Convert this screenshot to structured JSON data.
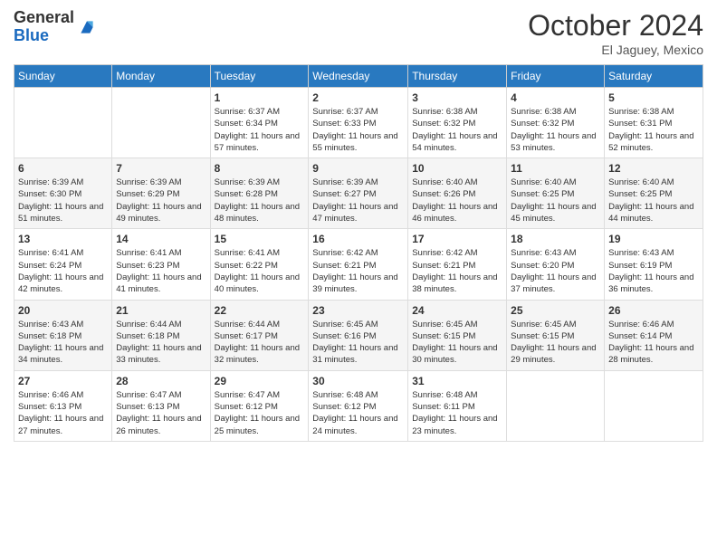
{
  "logo": {
    "general": "General",
    "blue": "Blue"
  },
  "title": "October 2024",
  "location": "El Jaguey, Mexico",
  "days_of_week": [
    "Sunday",
    "Monday",
    "Tuesday",
    "Wednesday",
    "Thursday",
    "Friday",
    "Saturday"
  ],
  "weeks": [
    [
      {
        "day": "",
        "sunrise": "",
        "sunset": "",
        "daylight": ""
      },
      {
        "day": "",
        "sunrise": "",
        "sunset": "",
        "daylight": ""
      },
      {
        "day": "1",
        "sunrise": "Sunrise: 6:37 AM",
        "sunset": "Sunset: 6:34 PM",
        "daylight": "Daylight: 11 hours and 57 minutes."
      },
      {
        "day": "2",
        "sunrise": "Sunrise: 6:37 AM",
        "sunset": "Sunset: 6:33 PM",
        "daylight": "Daylight: 11 hours and 55 minutes."
      },
      {
        "day": "3",
        "sunrise": "Sunrise: 6:38 AM",
        "sunset": "Sunset: 6:32 PM",
        "daylight": "Daylight: 11 hours and 54 minutes."
      },
      {
        "day": "4",
        "sunrise": "Sunrise: 6:38 AM",
        "sunset": "Sunset: 6:32 PM",
        "daylight": "Daylight: 11 hours and 53 minutes."
      },
      {
        "day": "5",
        "sunrise": "Sunrise: 6:38 AM",
        "sunset": "Sunset: 6:31 PM",
        "daylight": "Daylight: 11 hours and 52 minutes."
      }
    ],
    [
      {
        "day": "6",
        "sunrise": "Sunrise: 6:39 AM",
        "sunset": "Sunset: 6:30 PM",
        "daylight": "Daylight: 11 hours and 51 minutes."
      },
      {
        "day": "7",
        "sunrise": "Sunrise: 6:39 AM",
        "sunset": "Sunset: 6:29 PM",
        "daylight": "Daylight: 11 hours and 49 minutes."
      },
      {
        "day": "8",
        "sunrise": "Sunrise: 6:39 AM",
        "sunset": "Sunset: 6:28 PM",
        "daylight": "Daylight: 11 hours and 48 minutes."
      },
      {
        "day": "9",
        "sunrise": "Sunrise: 6:39 AM",
        "sunset": "Sunset: 6:27 PM",
        "daylight": "Daylight: 11 hours and 47 minutes."
      },
      {
        "day": "10",
        "sunrise": "Sunrise: 6:40 AM",
        "sunset": "Sunset: 6:26 PM",
        "daylight": "Daylight: 11 hours and 46 minutes."
      },
      {
        "day": "11",
        "sunrise": "Sunrise: 6:40 AM",
        "sunset": "Sunset: 6:25 PM",
        "daylight": "Daylight: 11 hours and 45 minutes."
      },
      {
        "day": "12",
        "sunrise": "Sunrise: 6:40 AM",
        "sunset": "Sunset: 6:25 PM",
        "daylight": "Daylight: 11 hours and 44 minutes."
      }
    ],
    [
      {
        "day": "13",
        "sunrise": "Sunrise: 6:41 AM",
        "sunset": "Sunset: 6:24 PM",
        "daylight": "Daylight: 11 hours and 42 minutes."
      },
      {
        "day": "14",
        "sunrise": "Sunrise: 6:41 AM",
        "sunset": "Sunset: 6:23 PM",
        "daylight": "Daylight: 11 hours and 41 minutes."
      },
      {
        "day": "15",
        "sunrise": "Sunrise: 6:41 AM",
        "sunset": "Sunset: 6:22 PM",
        "daylight": "Daylight: 11 hours and 40 minutes."
      },
      {
        "day": "16",
        "sunrise": "Sunrise: 6:42 AM",
        "sunset": "Sunset: 6:21 PM",
        "daylight": "Daylight: 11 hours and 39 minutes."
      },
      {
        "day": "17",
        "sunrise": "Sunrise: 6:42 AM",
        "sunset": "Sunset: 6:21 PM",
        "daylight": "Daylight: 11 hours and 38 minutes."
      },
      {
        "day": "18",
        "sunrise": "Sunrise: 6:43 AM",
        "sunset": "Sunset: 6:20 PM",
        "daylight": "Daylight: 11 hours and 37 minutes."
      },
      {
        "day": "19",
        "sunrise": "Sunrise: 6:43 AM",
        "sunset": "Sunset: 6:19 PM",
        "daylight": "Daylight: 11 hours and 36 minutes."
      }
    ],
    [
      {
        "day": "20",
        "sunrise": "Sunrise: 6:43 AM",
        "sunset": "Sunset: 6:18 PM",
        "daylight": "Daylight: 11 hours and 34 minutes."
      },
      {
        "day": "21",
        "sunrise": "Sunrise: 6:44 AM",
        "sunset": "Sunset: 6:18 PM",
        "daylight": "Daylight: 11 hours and 33 minutes."
      },
      {
        "day": "22",
        "sunrise": "Sunrise: 6:44 AM",
        "sunset": "Sunset: 6:17 PM",
        "daylight": "Daylight: 11 hours and 32 minutes."
      },
      {
        "day": "23",
        "sunrise": "Sunrise: 6:45 AM",
        "sunset": "Sunset: 6:16 PM",
        "daylight": "Daylight: 11 hours and 31 minutes."
      },
      {
        "day": "24",
        "sunrise": "Sunrise: 6:45 AM",
        "sunset": "Sunset: 6:15 PM",
        "daylight": "Daylight: 11 hours and 30 minutes."
      },
      {
        "day": "25",
        "sunrise": "Sunrise: 6:45 AM",
        "sunset": "Sunset: 6:15 PM",
        "daylight": "Daylight: 11 hours and 29 minutes."
      },
      {
        "day": "26",
        "sunrise": "Sunrise: 6:46 AM",
        "sunset": "Sunset: 6:14 PM",
        "daylight": "Daylight: 11 hours and 28 minutes."
      }
    ],
    [
      {
        "day": "27",
        "sunrise": "Sunrise: 6:46 AM",
        "sunset": "Sunset: 6:13 PM",
        "daylight": "Daylight: 11 hours and 27 minutes."
      },
      {
        "day": "28",
        "sunrise": "Sunrise: 6:47 AM",
        "sunset": "Sunset: 6:13 PM",
        "daylight": "Daylight: 11 hours and 26 minutes."
      },
      {
        "day": "29",
        "sunrise": "Sunrise: 6:47 AM",
        "sunset": "Sunset: 6:12 PM",
        "daylight": "Daylight: 11 hours and 25 minutes."
      },
      {
        "day": "30",
        "sunrise": "Sunrise: 6:48 AM",
        "sunset": "Sunset: 6:12 PM",
        "daylight": "Daylight: 11 hours and 24 minutes."
      },
      {
        "day": "31",
        "sunrise": "Sunrise: 6:48 AM",
        "sunset": "Sunset: 6:11 PM",
        "daylight": "Daylight: 11 hours and 23 minutes."
      },
      {
        "day": "",
        "sunrise": "",
        "sunset": "",
        "daylight": ""
      },
      {
        "day": "",
        "sunrise": "",
        "sunset": "",
        "daylight": ""
      }
    ]
  ]
}
